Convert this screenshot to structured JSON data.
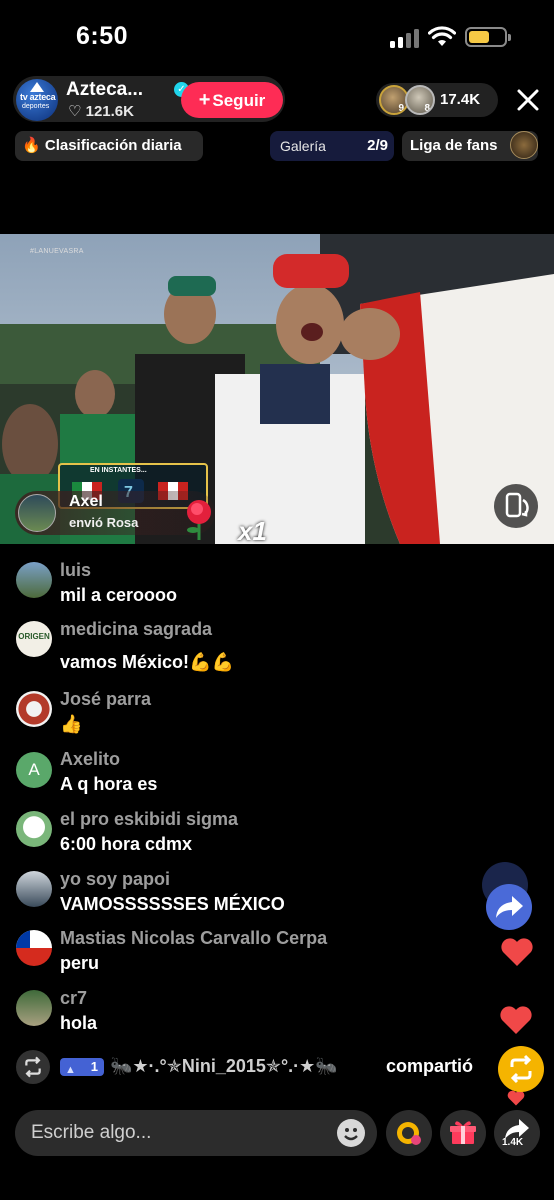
{
  "status_bar": {
    "time": "6:50"
  },
  "host": {
    "name": "Azteca...",
    "likes": "♡ 121.6K",
    "follow_label": "Seguir",
    "logo_text_1": "tv azteca",
    "logo_text_2": "deportes"
  },
  "viewers": {
    "top1_badge": "9",
    "top2_badge": "8",
    "count": "17.4K"
  },
  "ranking": {
    "label": "Clasificación diaria"
  },
  "gallery": {
    "label": "Galería",
    "page": "2/9"
  },
  "fan_league": {
    "label": "Liga de fans"
  },
  "video": {
    "watermark": "#LANUEVASRA",
    "overlay_tag": "EN INSTANTES...",
    "gift_user": "Axel",
    "gift_action": "envió Rosa",
    "gift_multiplier": "x1"
  },
  "comments": [
    {
      "user": "luis",
      "text": "mil a ceroooo"
    },
    {
      "user": "medicina sagrada",
      "text": "vamos México!💪💪"
    },
    {
      "user": "José parra",
      "text": "👍"
    },
    {
      "user": "Axelito",
      "text": "A q hora es",
      "avatar_letter": "A"
    },
    {
      "user": "el pro eskibidi sigma",
      "text": "6:00 hora cdmx"
    },
    {
      "user": "yo soy papoi",
      "text": "VAMOSSSSSSES MÉXICO"
    },
    {
      "user": "Mastias Nicolas Carvallo Cerpa",
      "text": "peru"
    },
    {
      "user": "cr7",
      "text": "hola"
    }
  ],
  "share_notice": {
    "level": "1",
    "user": "🐜★·.°✯Nini_2015✯°.·★🐜",
    "action": "compartió"
  },
  "bottom_bar": {
    "placeholder": "Escribe algo...",
    "share_count": "1.4K"
  },
  "colors": {
    "follow": "#fe2c55",
    "verified": "#20d5ec",
    "share_fab": "#4a6ad8",
    "repost_fab": "#f5b400",
    "heart": "#f04848"
  }
}
